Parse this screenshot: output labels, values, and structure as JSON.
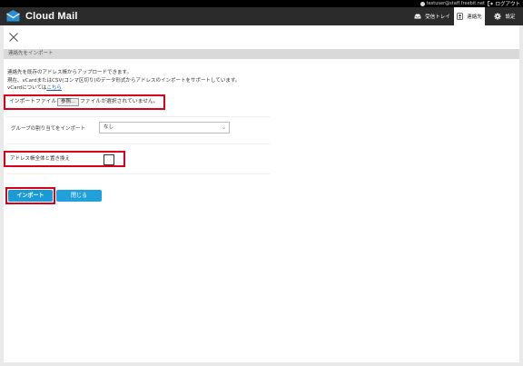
{
  "app": {
    "name": "Cloud Mail",
    "user": "testuser@staff.freebit.net",
    "logout": "ログアウト"
  },
  "nav": {
    "inbox": "受信トレイ",
    "contacts": "連絡先",
    "settings": "設定"
  },
  "dialog": {
    "title": "連絡先をインポート",
    "desc_line1": "連絡先を既存のアドレス帳からアップロードできます。",
    "desc_line2": "現在、vCardまたはCSV(コンマ区切り)のデータ形式からアドレスのインポートをサポートしています。",
    "desc_line3_prefix": "vCardについては",
    "desc_line3_link": "こちら",
    "file_label": "インポートファイル",
    "browse_label": "参照...",
    "no_file_text": "ファイルが選択されていません。",
    "group_label": "グループの割り当てをインポート",
    "group_value": "なし",
    "overwrite_label": "アドレス帳全体と置き換え",
    "overwrite_checked": false,
    "import_button": "インポート",
    "close_button": "閉じる"
  },
  "colors": {
    "header_bg": "#2b2b2b",
    "accent": "#1a9ad6",
    "highlight": "#d8001b"
  }
}
